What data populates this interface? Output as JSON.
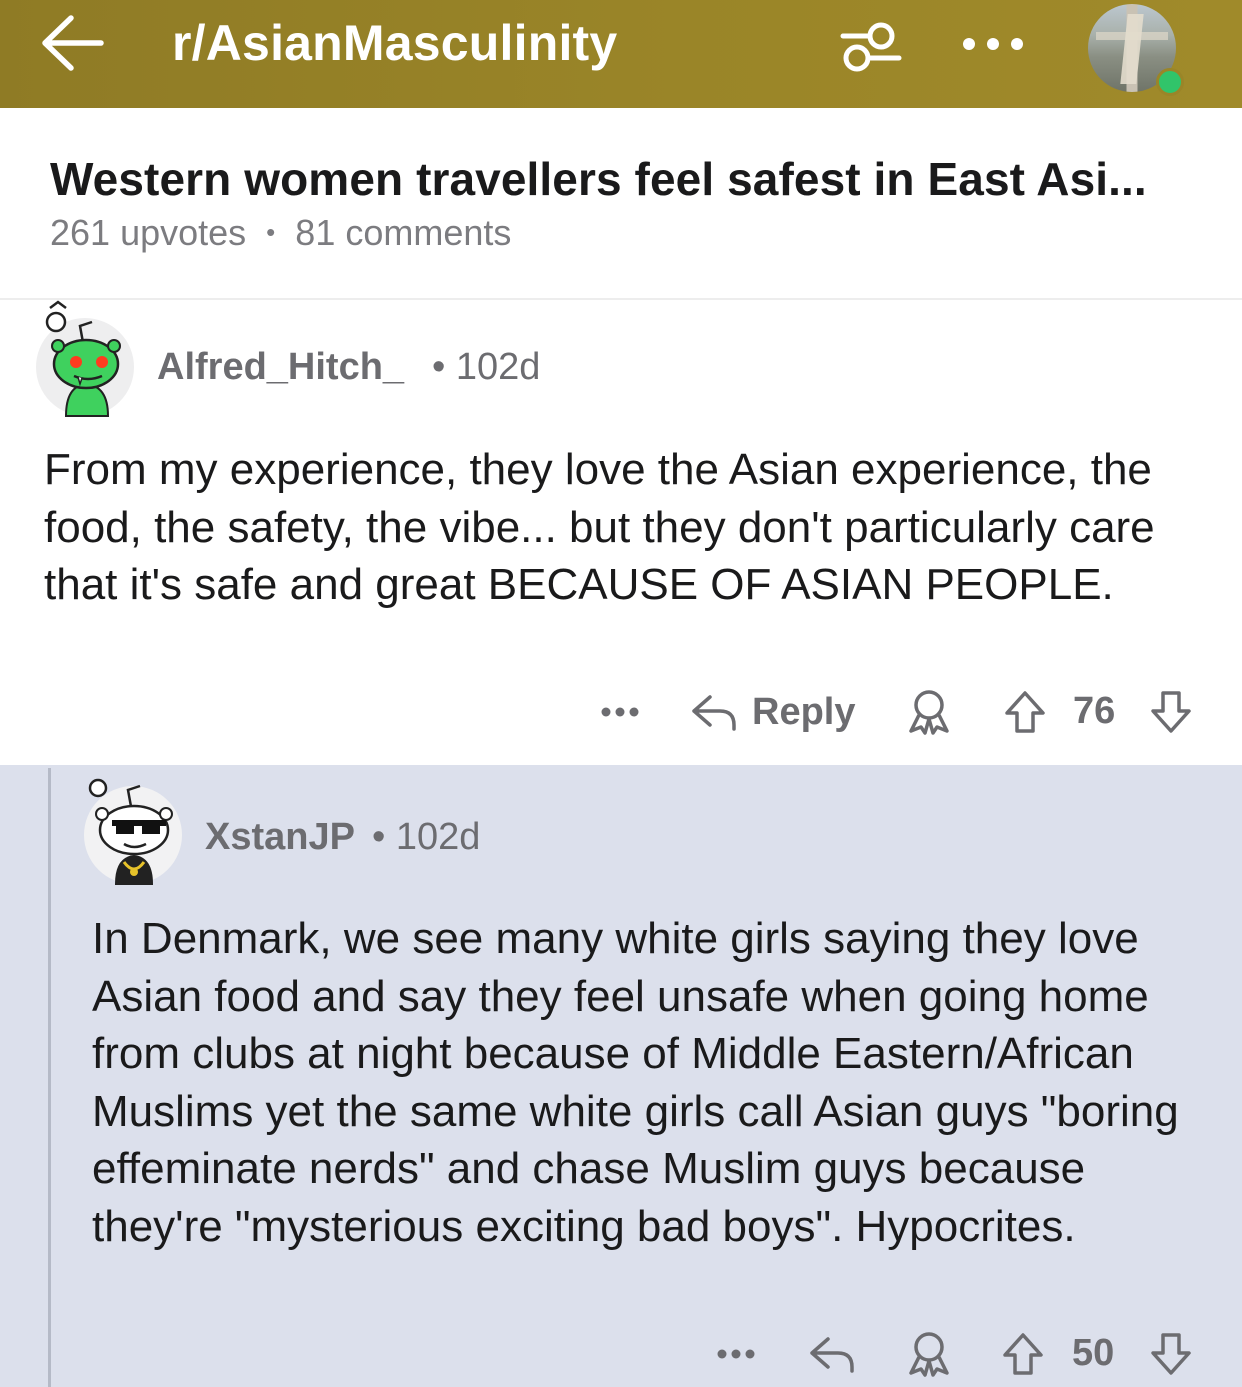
{
  "header": {
    "subreddit": "r/AsianMasculinity"
  },
  "post": {
    "title": "Western women travellers feel safest in East Asi...",
    "upvotes": "261 upvotes",
    "separator": "•",
    "comments": "81 comments"
  },
  "comments": [
    {
      "username": "Alfred_Hitch_",
      "age": "• 102d",
      "body": "From my experience, they love the Asian experience, the food, the safety, the vibe... but they don't particularly care that it's safe and great BECAUSE OF ASIAN PEOPLE.",
      "reply_label": "Reply",
      "score": "76"
    },
    {
      "username": "XstanJP",
      "age": "• 102d",
      "body": "In Denmark, we see many white girls saying they love Asian food and say they feel unsafe when going home from clubs at night because of Middle Eastern/African Muslims yet the same white girls call Asian guys \"boring effeminate nerds\" and chase Muslim guys because they're  \"mysterious exciting bad boys\". Hypocrites.",
      "score": "50"
    }
  ],
  "icons": {
    "back": "arrow-left-icon",
    "filter": "sliders-icon",
    "more": "more-horizontal-icon",
    "award": "award-icon",
    "upvote": "upvote-arrow-icon",
    "downvote": "downvote-arrow-icon",
    "reply": "reply-arrow-icon"
  },
  "colors": {
    "header_bg": "#9a8528",
    "reply_bg": "#dce0ec",
    "online": "#31c46a",
    "meta_text": "#6c6c70"
  }
}
